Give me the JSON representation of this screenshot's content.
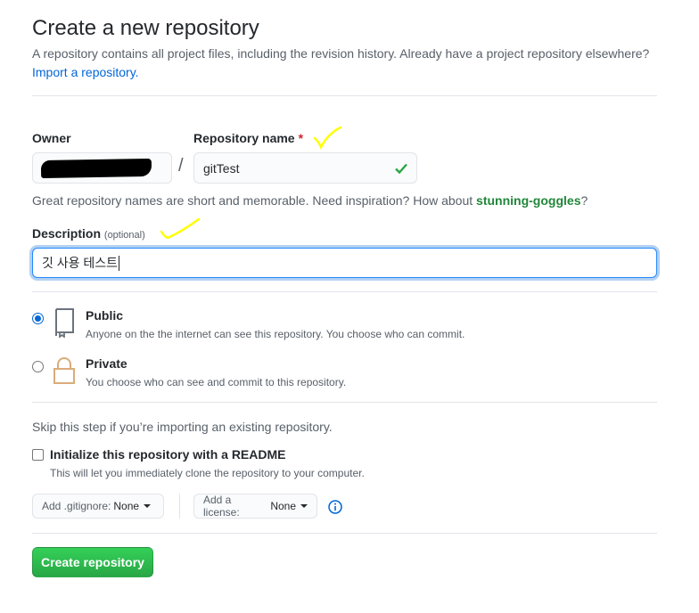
{
  "header": {
    "title": "Create a new repository",
    "subtitle": "A repository contains all project files, including the revision history. Already have a project repository elsewhere?",
    "import_link": "Import a repository."
  },
  "owner": {
    "label": "Owner"
  },
  "repo": {
    "label": "Repository name",
    "required_mark": "*",
    "slash": "/",
    "value": "gitTest"
  },
  "hint": {
    "text": "Great repository names are short and memorable. Need inspiration? How about ",
    "suggestion": "stunning-goggles",
    "end": "?"
  },
  "description": {
    "label": "Description",
    "optional": "(optional)",
    "value": "깃 사용 테스트"
  },
  "visibility": {
    "public_title": "Public",
    "public_desc": "Anyone on the the internet can see this repository. You choose who can commit.",
    "private_title": "Private",
    "private_desc": "You choose who can see and commit to this repository.",
    "selected": "public"
  },
  "init": {
    "skip_text": "Skip this step if you’re importing an existing repository.",
    "readme_label": "Initialize this repository with a README",
    "readme_desc": "This will let you immediately clone the repository to your computer.",
    "gitignore_prefix": "Add .gitignore:",
    "gitignore_value": "None",
    "license_prefix": "Add a license:",
    "license_value": "None"
  },
  "actions": {
    "create_label": "Create repository"
  },
  "colors": {
    "accent_blue": "#0366d6",
    "create_green": "#28a745",
    "annotation_yellow": "#ffff00"
  }
}
